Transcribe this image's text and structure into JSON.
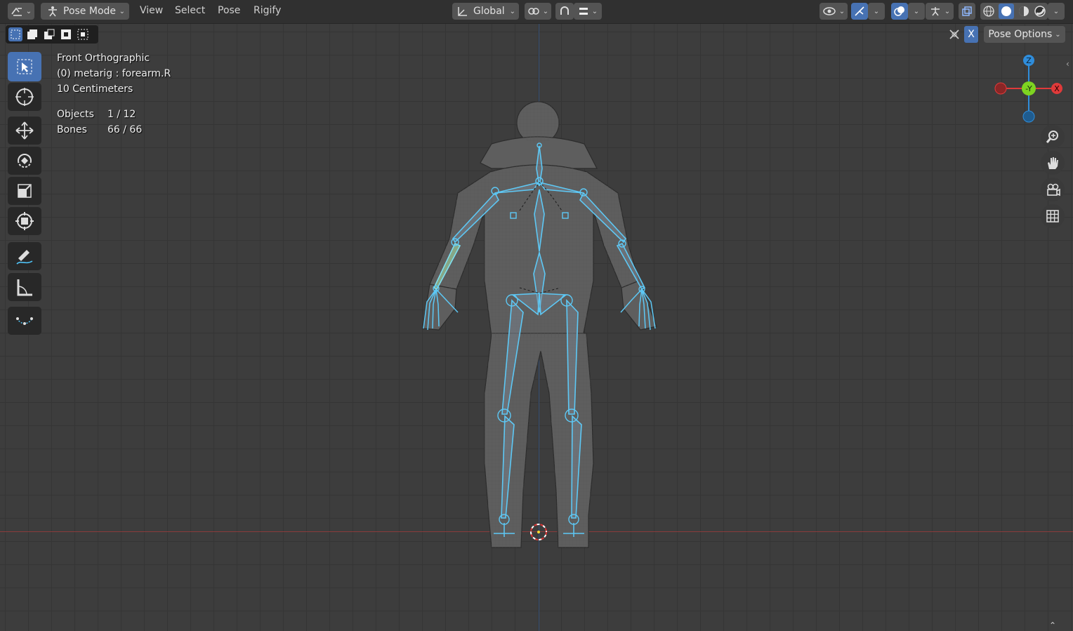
{
  "header": {
    "mode_label": "Pose Mode",
    "menus": [
      "View",
      "Select",
      "Pose",
      "Rigify"
    ],
    "orientation_label": "Global"
  },
  "header_right": {
    "pose_options_label": "Pose Options",
    "x_mirror_label": "X"
  },
  "overlay": {
    "view_name": "Front Orthographic",
    "active_object": "(0) metarig : forearm.R",
    "grid_scale": "10 Centimeters",
    "objects_label": "Objects",
    "objects_value": "1 / 12",
    "bones_label": "Bones",
    "bones_value": "66 / 66"
  },
  "gizmo": {
    "z_label": "Z",
    "y_label": "-Y",
    "x_label": "X"
  },
  "colors": {
    "accent": "#4772b3",
    "bone": "#4fc3f7",
    "axis_x": "#e03a3a",
    "axis_y": "#7ed321",
    "axis_z": "#2f8ddb"
  },
  "icons": [
    "editor-type-icon",
    "pose-mode-icon",
    "transform-orientation-icon",
    "pivot-icon",
    "snap-icon",
    "visibility-icon",
    "gizmo-icon",
    "overlay-icon",
    "xray-icon",
    "shading-wireframe-icon",
    "shading-solid-icon",
    "shading-material-icon",
    "shading-rendered-icon",
    "select-box-icon",
    "cursor-icon",
    "move-icon",
    "rotate-icon",
    "scale-icon",
    "transform-icon",
    "annotate-icon",
    "measure-icon",
    "relax-pose-icon",
    "zoom-icon",
    "pan-hand-icon",
    "camera-icon",
    "grid-icon"
  ]
}
